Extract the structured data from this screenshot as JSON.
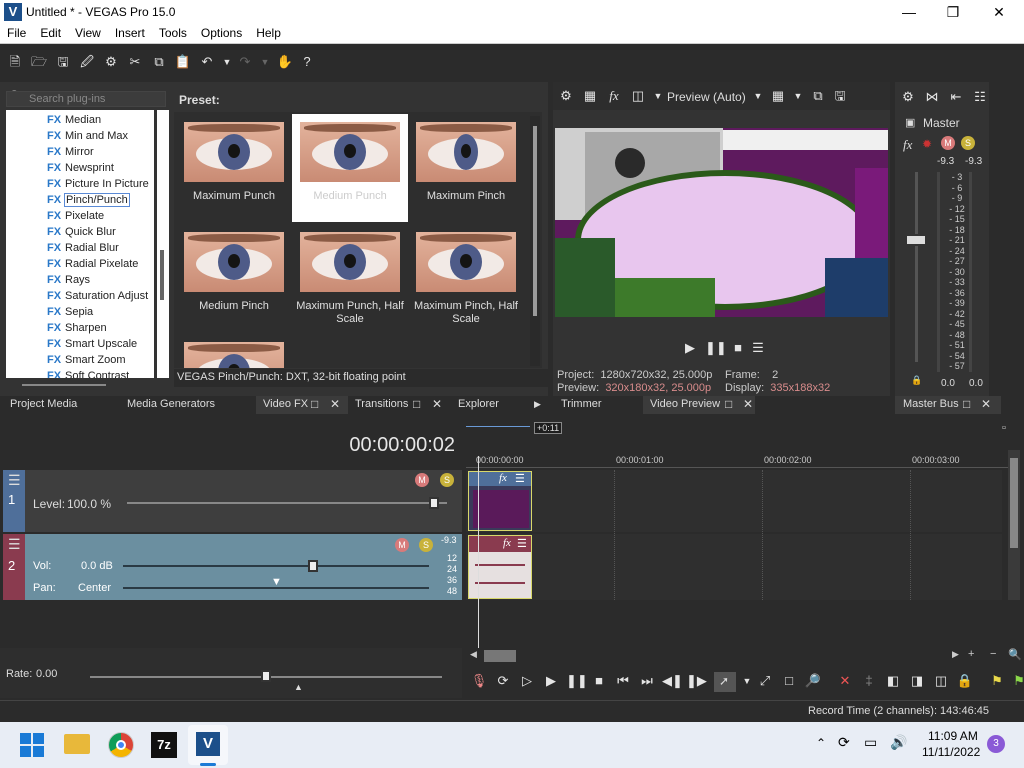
{
  "window": {
    "title": "Untitled * - VEGAS Pro 15.0",
    "logo": "V",
    "controls": [
      "minimize-icon",
      "maximize-icon",
      "close-icon"
    ]
  },
  "menu": [
    "File",
    "Edit",
    "View",
    "Insert",
    "Tools",
    "Options",
    "Help"
  ],
  "plugins": {
    "search_placeholder": "Search plug-ins",
    "fx_tag": "FX",
    "items": [
      {
        "label": "Median",
        "selected": false
      },
      {
        "label": "Min and Max",
        "selected": false
      },
      {
        "label": "Mirror",
        "selected": false
      },
      {
        "label": "Newsprint",
        "selected": false
      },
      {
        "label": "Picture In Picture",
        "selected": false
      },
      {
        "label": "Pinch/Punch",
        "selected": true
      },
      {
        "label": "Pixelate",
        "selected": false
      },
      {
        "label": "Quick Blur",
        "selected": false
      },
      {
        "label": "Radial Blur",
        "selected": false
      },
      {
        "label": "Radial Pixelate",
        "selected": false
      },
      {
        "label": "Rays",
        "selected": false
      },
      {
        "label": "Saturation Adjust",
        "selected": false
      },
      {
        "label": "Sepia",
        "selected": false
      },
      {
        "label": "Sharpen",
        "selected": false
      },
      {
        "label": "Smart Upscale",
        "selected": false
      },
      {
        "label": "Smart Zoom",
        "selected": false
      },
      {
        "label": "Soft Contrast",
        "selected": false
      }
    ],
    "preset_label": "Preset:",
    "presets": [
      {
        "label": "Maximum Punch",
        "selected": false
      },
      {
        "label": "Medium Punch",
        "selected": true
      },
      {
        "label": "Maximum Pinch",
        "selected": false
      },
      {
        "label": "Medium Pinch",
        "selected": false
      },
      {
        "label": "Maximum Punch, Half Scale",
        "selected": false
      },
      {
        "label": "Maximum Pinch, Half Scale",
        "selected": false
      },
      {
        "label": "",
        "selected": false
      }
    ],
    "status": "VEGAS Pinch/Punch: DXT, 32-bit floating point"
  },
  "dock_tabs": {
    "left": [
      "Project Media",
      "Media Generators",
      "Video FX",
      "Transitions",
      "Explorer"
    ],
    "preview": [
      "Trimmer",
      "Video Preview"
    ],
    "master": [
      "Master Bus"
    ]
  },
  "preview": {
    "mode": "Preview (Auto)",
    "info": {
      "project_label": "Project:",
      "project": "1280x720x32, 25.000p",
      "frame_label": "Frame:",
      "frame": "2",
      "preview_label": "Preview:",
      "preview": "320x180x32, 25.000p",
      "display_label": "Display:",
      "display": "335x188x32"
    }
  },
  "master": {
    "label": "Master",
    "peak_left": "-9.3",
    "peak_right": "-9.3",
    "scale": [
      "3",
      "6",
      "9",
      "12",
      "15",
      "18",
      "21",
      "24",
      "27",
      "30",
      "33",
      "36",
      "39",
      "42",
      "45",
      "48",
      "51",
      "54",
      "57"
    ],
    "level_left": "0.0",
    "level_right": "0.0"
  },
  "timeline": {
    "timecode": "00:00:00:02",
    "position_marker": "+0:11",
    "ruler": [
      "00:00:00:00",
      "00:00:01:00",
      "00:00:02:00",
      "00:00:03:00"
    ],
    "video_track": {
      "number": "1",
      "level_label": "Level:",
      "level_value": "100.0 %",
      "level_fraction": 0.96
    },
    "audio_track": {
      "number": "2",
      "vol_label": "Vol:",
      "vol_value": "0.0 dB",
      "pan_label": "Pan:",
      "pan_value": "Center",
      "peak": "-9.3",
      "db_marks": [
        "12",
        "24",
        "36",
        "48"
      ],
      "vol_fraction": 0.62,
      "pan_fraction": 0.5
    },
    "rate_label": "Rate:",
    "rate_value": "0.00",
    "rate_fraction": 0.5
  },
  "status_bar": {
    "record_time": "Record Time (2 channels): 143:46:45"
  },
  "taskbar": {
    "time": "11:09 AM",
    "date": "11/11/2022",
    "notifications": "3",
    "apps": [
      "windows-start",
      "file-explorer",
      "chrome",
      "7zip",
      "vegas"
    ],
    "seven_zip_label": "7z",
    "vegas_label": "V"
  }
}
